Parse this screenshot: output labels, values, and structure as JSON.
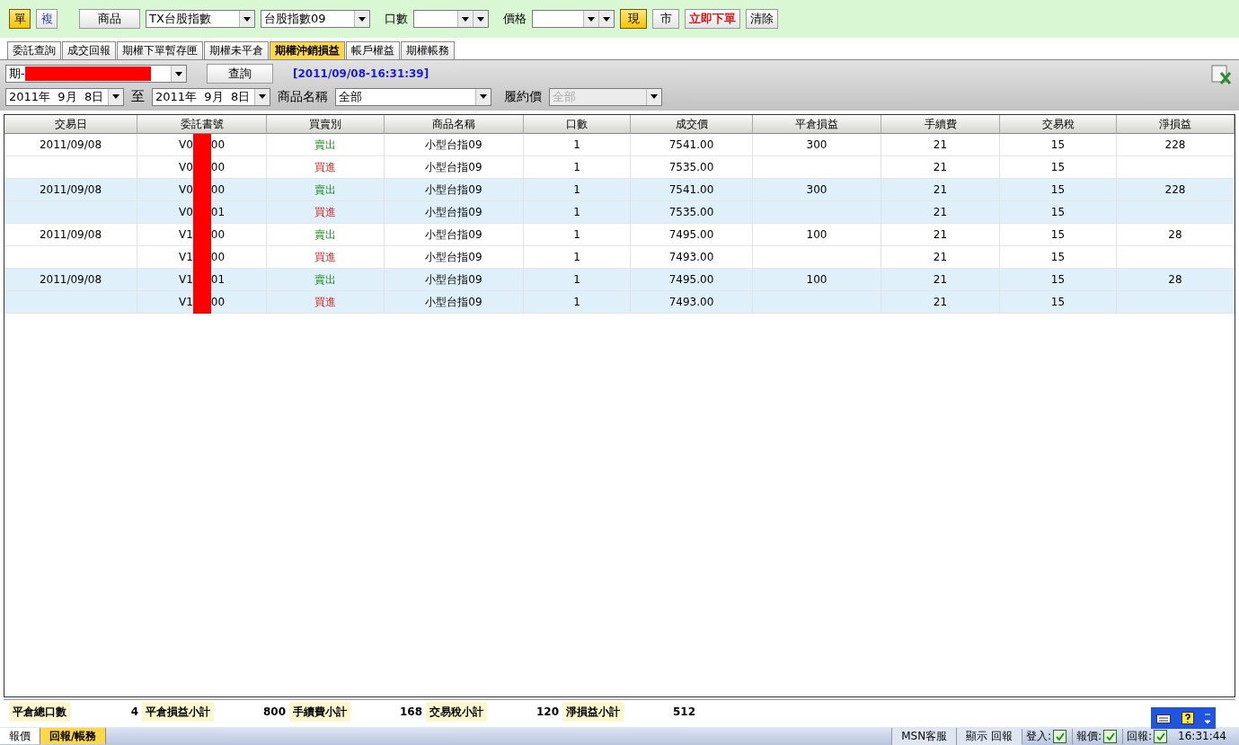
{
  "toolbar": {
    "mode_buttons": [
      {
        "label": "單",
        "selected": true
      },
      {
        "label": "複",
        "selected": false
      }
    ],
    "product_button": "商品",
    "product_select": "TX台股指數",
    "contract_select": "台股指數09",
    "qty_label": "口數",
    "price_label": "價格",
    "price_buttons": [
      {
        "label": "現",
        "selected": true
      },
      {
        "label": "市",
        "selected": false
      }
    ],
    "submit_button": "立即下單",
    "clear_button": "清除"
  },
  "tabs": [
    {
      "label": "委託查詢",
      "selected": false
    },
    {
      "label": "成交回報",
      "selected": false
    },
    {
      "label": "期權下單暫存匣",
      "selected": false
    },
    {
      "label": "期權未平倉",
      "selected": false
    },
    {
      "label": "期權沖銷損益",
      "selected": true
    },
    {
      "label": "帳戶權益",
      "selected": false
    },
    {
      "label": "期權帳務",
      "selected": false
    }
  ],
  "filters": {
    "account_prefix": "期-",
    "query_button": "查詢",
    "timestamp": "[2011/09/08-16:31:39]",
    "date_from": "2011年  9月  8日",
    "to_label": "至",
    "date_to": "2011年  9月  8日",
    "product_label": "商品名稱",
    "product_value": "全部",
    "strike_label": "履約價",
    "strike_value": "全部"
  },
  "table": {
    "columns": [
      "交易日",
      "委託書號",
      "買賣別",
      "商品名稱",
      "口數",
      "成交價",
      "平倉損益",
      "手續費",
      "交易稅",
      "淨損益"
    ],
    "rows": [
      {
        "date": "2011/09/08",
        "order_prefix": "V0",
        "order_suffix": "00",
        "kind": "sell",
        "side": "賣出",
        "product": "小型台指09",
        "qty": "1",
        "price": "7541.00",
        "close_pl": "300",
        "fee": "21",
        "tax": "15",
        "net": "228"
      },
      {
        "date": "",
        "order_prefix": "V0",
        "order_suffix": "00",
        "kind": "buy",
        "side": "買進",
        "product": "小型台指09",
        "qty": "1",
        "price": "7535.00",
        "close_pl": "",
        "fee": "21",
        "tax": "15",
        "net": ""
      },
      {
        "date": "2011/09/08",
        "order_prefix": "V0",
        "order_suffix": "00",
        "kind": "sell",
        "side": "賣出",
        "product": "小型台指09",
        "qty": "1",
        "price": "7541.00",
        "close_pl": "300",
        "fee": "21",
        "tax": "15",
        "net": "228"
      },
      {
        "date": "",
        "order_prefix": "V0",
        "order_suffix": "01",
        "kind": "buy",
        "side": "買進",
        "product": "小型台指09",
        "qty": "1",
        "price": "7535.00",
        "close_pl": "",
        "fee": "21",
        "tax": "15",
        "net": ""
      },
      {
        "date": "2011/09/08",
        "order_prefix": "V1",
        "order_suffix": "00",
        "kind": "sell",
        "side": "賣出",
        "product": "小型台指09",
        "qty": "1",
        "price": "7495.00",
        "close_pl": "100",
        "fee": "21",
        "tax": "15",
        "net": "28"
      },
      {
        "date": "",
        "order_prefix": "V1",
        "order_suffix": "00",
        "kind": "buy",
        "side": "買進",
        "product": "小型台指09",
        "qty": "1",
        "price": "7493.00",
        "close_pl": "",
        "fee": "21",
        "tax": "15",
        "net": ""
      },
      {
        "date": "2011/09/08",
        "order_prefix": "V1",
        "order_suffix": "01",
        "kind": "sell",
        "side": "賣出",
        "product": "小型台指09",
        "qty": "1",
        "price": "7495.00",
        "close_pl": "100",
        "fee": "21",
        "tax": "15",
        "net": "28"
      },
      {
        "date": "",
        "order_prefix": "V1",
        "order_suffix": "00",
        "kind": "buy",
        "side": "買進",
        "product": "小型台指09",
        "qty": "1",
        "price": "7493.00",
        "close_pl": "",
        "fee": "21",
        "tax": "15",
        "net": ""
      }
    ]
  },
  "summary": [
    {
      "label": "平倉總口數",
      "value": "4"
    },
    {
      "label": "平倉損益小計",
      "value": "800"
    },
    {
      "label": "手續費小計",
      "value": "168"
    },
    {
      "label": "交易稅小計",
      "value": "120"
    },
    {
      "label": "淨損益小計",
      "value": "512"
    }
  ],
  "bottom_tabs": [
    {
      "label": "報價",
      "selected": false
    },
    {
      "label": "回報/帳務",
      "selected": true
    }
  ],
  "status_bar": {
    "buttons": [
      "MSN客服",
      "顯示 回報"
    ],
    "indicators": [
      {
        "label": "登入:",
        "checked": true
      },
      {
        "label": "報價:",
        "checked": true
      },
      {
        "label": "回報:",
        "checked": true
      }
    ],
    "time": "16:31:44"
  }
}
